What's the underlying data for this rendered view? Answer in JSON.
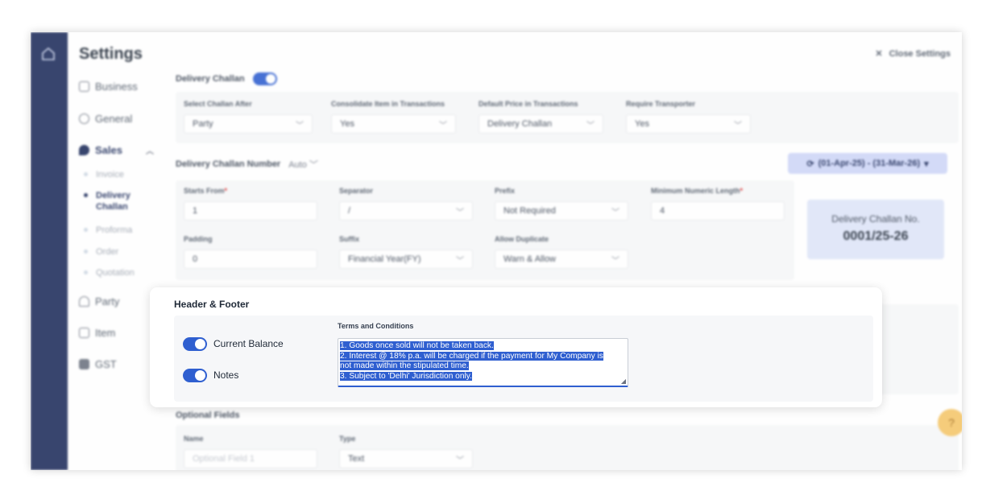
{
  "sidebar": {
    "title": "Settings",
    "items": [
      {
        "label": "Business",
        "icon": "briefcase-icon"
      },
      {
        "label": "General",
        "icon": "gear-icon"
      },
      {
        "label": "Sales",
        "icon": "tag-icon"
      },
      {
        "label": "Party",
        "icon": "users-icon"
      },
      {
        "label": "Item",
        "icon": "box-icon"
      },
      {
        "label": "GST",
        "icon": "receipt-icon"
      }
    ],
    "sales_subitems": [
      "Invoice",
      "Delivery Challan",
      "Proforma",
      "Order",
      "Quotation"
    ],
    "active_subitem": "Delivery Challan"
  },
  "header": {
    "close_label": "Close Settings"
  },
  "delivery_challan": {
    "title": "Delivery Challan",
    "enabled": true,
    "fields": [
      {
        "label": "Select Challan After",
        "value": "Party"
      },
      {
        "label": "Consolidate Item in Transactions",
        "value": "Yes"
      },
      {
        "label": "Default Price in Transactions",
        "value": "Delivery Challan"
      },
      {
        "label": "Require Transporter",
        "value": "Yes"
      }
    ]
  },
  "numbering": {
    "title": "Delivery Challan Number",
    "mode": "Auto",
    "fy_button": "(01-Apr-25) - (31-Mar-26)",
    "starts_from_label": "Starts From",
    "starts_from_value": "1",
    "separator_label": "Separator",
    "separator_value": "/",
    "prefix_label": "Prefix",
    "prefix_value": "Not Required",
    "min_length_label": "Minimum Numeric Length",
    "min_length_value": "4",
    "padding_label": "Padding",
    "padding_value": "0",
    "suffix_label": "Suffix",
    "suffix_value": "Financial Year(FY)",
    "duplicate_label": "Allow Duplicate",
    "duplicate_value": "Warn & Allow",
    "preview_label": "Delivery Challan No.",
    "preview_value": "0001/25-26"
  },
  "header_footer": {
    "title": "Header & Footer",
    "current_balance_label": "Current Balance",
    "current_balance_on": true,
    "notes_label": "Notes",
    "notes_on": true,
    "terms_label": "Terms and Conditions",
    "terms_lines": [
      "1. Goods once sold will not be taken back.",
      "2. Interest @ 18% p.a. will be charged if the payment for My Company is",
      "not made within the stipulated time.",
      "3. Subject to 'Delhi' Jurisdiction only."
    ]
  },
  "optional_fields": {
    "title": "Optional Fields",
    "name_label": "Name",
    "name_placeholder": "Optional Field 1",
    "type_label": "Type",
    "type_value": "Text"
  },
  "colors": {
    "accent": "#2f5fd0",
    "rail": "#1e2d5c",
    "fy_button_bg": "#cfd6f7",
    "help_button": "#f5c76a"
  }
}
